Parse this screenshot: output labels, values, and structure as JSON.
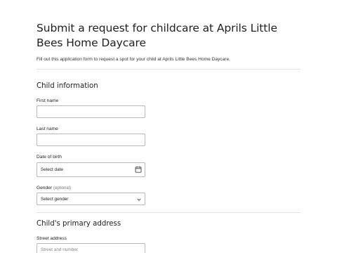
{
  "page": {
    "title": "Submit a request for childcare at Aprils Little Bees Home Daycare",
    "intro": "Fill out this application form to request a spot for your child at Aprils Little Bees Home Daycare."
  },
  "child_info": {
    "heading": "Child information",
    "first_name": {
      "label": "First name",
      "value": ""
    },
    "last_name": {
      "label": "Last name",
      "value": ""
    },
    "dob": {
      "label": "Date of birth",
      "value": "Select date",
      "icon": "calendar-icon"
    },
    "gender": {
      "label": "Gender",
      "optional": "(optional)",
      "value": "Select gender",
      "icon": "chevron-down-icon"
    }
  },
  "address": {
    "heading": "Child's primary address",
    "street": {
      "label": "Street address",
      "placeholder": "Street and number"
    }
  }
}
